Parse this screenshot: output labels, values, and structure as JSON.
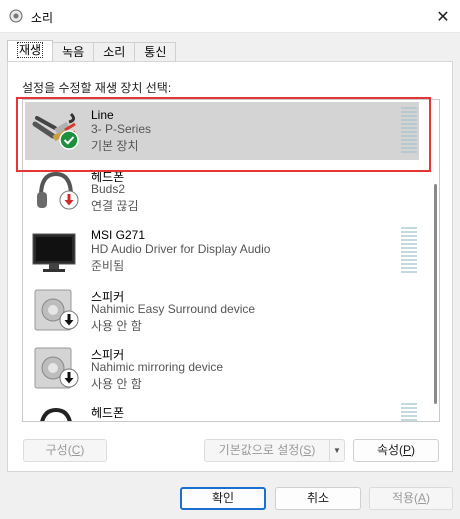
{
  "window": {
    "title": "소리",
    "close_glyph": "✕"
  },
  "tabs": [
    {
      "label": "재생",
      "active": true
    },
    {
      "label": "녹음"
    },
    {
      "label": "소리"
    },
    {
      "label": "통신"
    }
  ],
  "panel": {
    "label": "설정을 수정할 재생 장치 선택:"
  },
  "devices": [
    {
      "name": "Line",
      "desc": "3- P-Series",
      "status": "기본 장치",
      "icon": "cable-icon",
      "badge": "default-check",
      "meter": true,
      "selected": true
    },
    {
      "name": "헤드폰",
      "desc": "Buds2",
      "status": "연결 끊김",
      "icon": "headphones-icon",
      "badge": "disconnected-red",
      "meter": false
    },
    {
      "name": "MSI G271",
      "desc": "HD Audio Driver for Display Audio",
      "status": "준비됨",
      "icon": "monitor-icon",
      "badge": "none",
      "meter": true
    },
    {
      "name": "스피커",
      "desc": "Nahimic Easy Surround device",
      "status": "사용 안 함",
      "icon": "speaker-icon",
      "badge": "disabled-black",
      "meter": false
    },
    {
      "name": "스피커",
      "desc": "Nahimic mirroring device",
      "status": "사용 안 함",
      "icon": "speaker-icon",
      "badge": "disabled-black",
      "meter": false
    },
    {
      "name": "헤드폰",
      "desc": "",
      "status": "",
      "icon": "headphones-icon",
      "badge": "none",
      "meter": true
    }
  ],
  "buttons": {
    "configure": {
      "label": "구성",
      "mnemonic": "C"
    },
    "set_default": {
      "label": "기본값으로 설정",
      "mnemonic": "S"
    },
    "properties": {
      "label": "속성",
      "mnemonic": "P"
    },
    "ok": "확인",
    "cancel": "취소",
    "apply": {
      "label": "적용",
      "mnemonic": "A"
    }
  },
  "colors": {
    "accent": "#1a6fd1",
    "highlight": "#e53535",
    "check_green": "#1e8f3e",
    "disconnect_red": "#d62828"
  }
}
